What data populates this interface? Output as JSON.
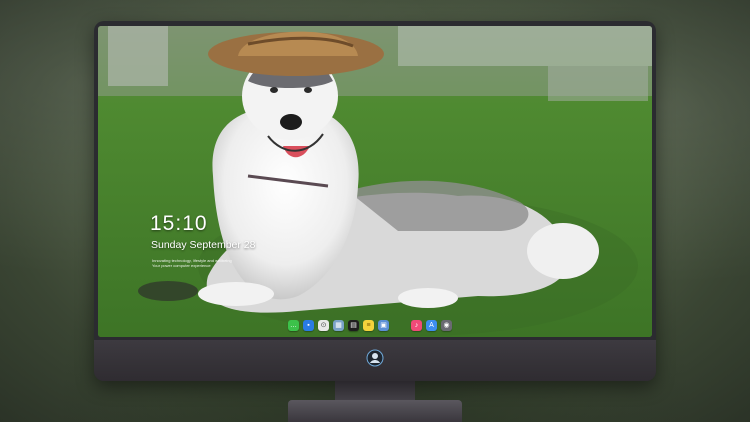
{
  "lock_screen": {
    "time": "15:10",
    "date": "Sunday September 28",
    "note_line1": "Innovating technology, lifestyle and wellbeing",
    "note_line2": "Your power computer experience"
  },
  "dock": {
    "apps": [
      {
        "name": "messages",
        "color": "#3cc24a",
        "glyph": "…"
      },
      {
        "name": "finder",
        "color": "#2a7be4",
        "glyph": "▪"
      },
      {
        "name": "safari",
        "color": "#e8e8e8",
        "glyph": "⊙"
      },
      {
        "name": "preview",
        "color": "#7aa2c8",
        "glyph": "▦"
      },
      {
        "name": "clapper",
        "color": "#1e1e1e",
        "glyph": "▤"
      },
      {
        "name": "notes",
        "color": "#f4d23c",
        "glyph": "≡"
      },
      {
        "name": "photos",
        "color": "#5b8fd6",
        "glyph": "▣"
      },
      {
        "name": "music",
        "color": "#f04a78",
        "glyph": "♪"
      },
      {
        "name": "app-store",
        "color": "#3d8ef0",
        "glyph": "A"
      },
      {
        "name": "camera",
        "color": "#6a6a72",
        "glyph": "◉"
      }
    ]
  }
}
